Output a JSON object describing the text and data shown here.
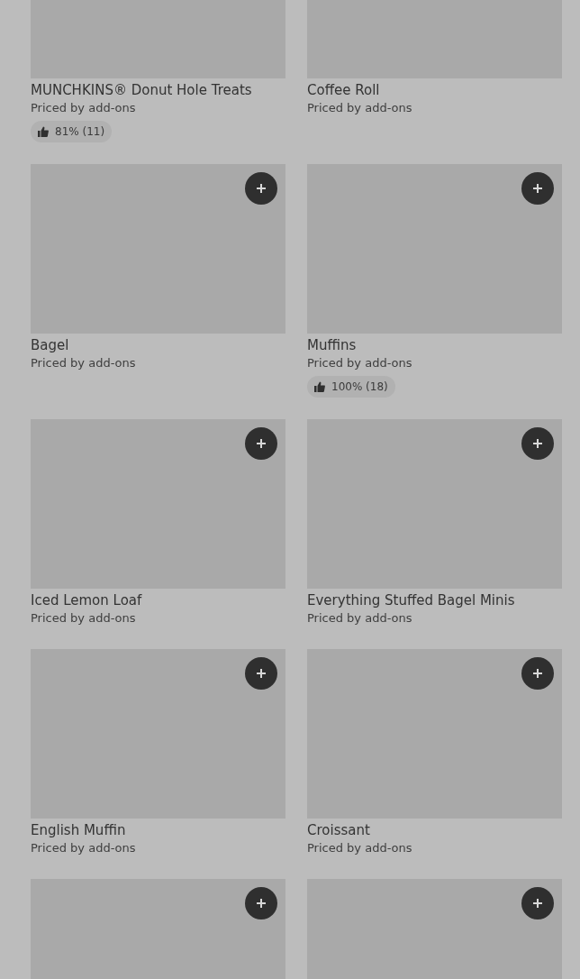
{
  "items": [
    {
      "kind": "cut-top",
      "title": "MUNCHKINS® Donut Hole Treats",
      "price": "Priced by add-ons",
      "rating": "81% (11)"
    },
    {
      "kind": "cut-top",
      "title": "Coffee Roll",
      "price": "Priced by add-ons"
    },
    {
      "kind": "card",
      "title": "Bagel",
      "price": "Priced by add-ons"
    },
    {
      "kind": "card",
      "title": "Muffins",
      "price": "Priced by add-ons",
      "rating": "100% (18)"
    },
    {
      "kind": "card",
      "title": "Iced Lemon Loaf",
      "price": "Priced by add-ons"
    },
    {
      "kind": "card",
      "title": "Everything Stuffed Bagel Minis",
      "price": "Priced by add-ons"
    },
    {
      "kind": "card",
      "title": "English Muffin",
      "price": "Priced by add-ons"
    },
    {
      "kind": "card",
      "title": "Croissant",
      "price": "Priced by add-ons"
    },
    {
      "kind": "image-only"
    },
    {
      "kind": "image-only"
    }
  ]
}
